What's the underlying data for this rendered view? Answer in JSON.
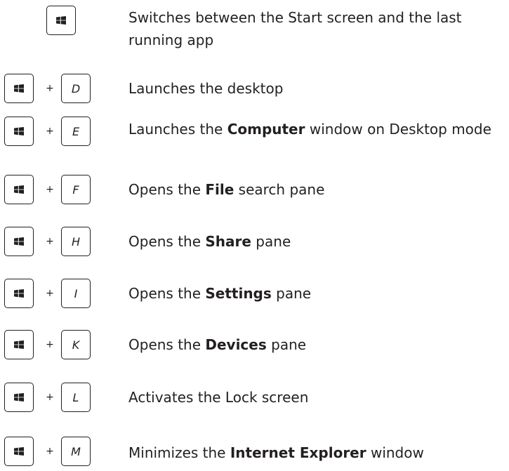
{
  "shortcuts": [
    {
      "key": "",
      "parts": [
        {
          "t": "Switches between the Start screen and the last running app",
          "b": false
        }
      ]
    },
    {
      "key": "D",
      "parts": [
        {
          "t": "Launches the desktop",
          "b": false
        }
      ]
    },
    {
      "key": "E",
      "parts": [
        {
          "t": "Launches the ",
          "b": false
        },
        {
          "t": "Computer",
          "b": true
        },
        {
          "t": " window on Desktop mode",
          "b": false
        }
      ]
    },
    {
      "key": "F",
      "parts": [
        {
          "t": "Opens the ",
          "b": false
        },
        {
          "t": "File",
          "b": true
        },
        {
          "t": " search pane",
          "b": false
        }
      ]
    },
    {
      "key": "H",
      "parts": [
        {
          "t": "Opens the ",
          "b": false
        },
        {
          "t": "Share",
          "b": true
        },
        {
          "t": " pane",
          "b": false
        }
      ]
    },
    {
      "key": "I",
      "parts": [
        {
          "t": "Opens the ",
          "b": false
        },
        {
          "t": "Settings",
          "b": true
        },
        {
          "t": " pane",
          "b": false
        }
      ]
    },
    {
      "key": "K",
      "parts": [
        {
          "t": "Opens the ",
          "b": false
        },
        {
          "t": "Devices",
          "b": true
        },
        {
          "t": " pane",
          "b": false
        }
      ]
    },
    {
      "key": "L",
      "parts": [
        {
          "t": "Activates the Lock screen",
          "b": false
        }
      ]
    },
    {
      "key": "M",
      "parts": [
        {
          "t": "Minimizes the ",
          "b": false
        },
        {
          "t": "Internet Explorer",
          "b": true
        },
        {
          "t": " window",
          "b": false
        }
      ]
    }
  ],
  "plus_sign": "+",
  "icons": {
    "windows_key": "windows-logo-icon"
  }
}
